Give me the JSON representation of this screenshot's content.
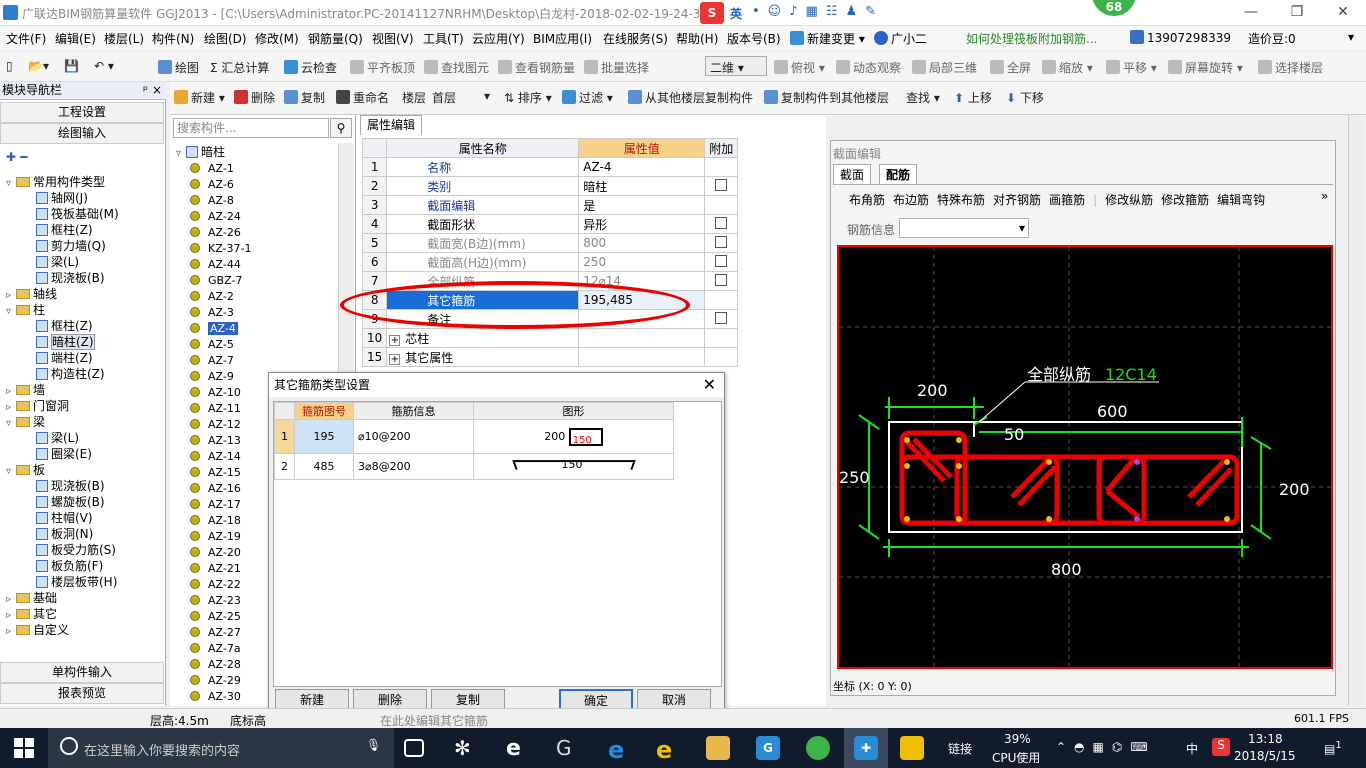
{
  "title": "广联达BIM钢筋算量软件 GGJ2013 - [C:\\Users\\Administrator.PC-20141127NRHM\\Desktop\\白龙村-2018-02-02-19-24-35",
  "ime": {
    "label": "英",
    "badge": "68"
  },
  "menu": [
    "文件(F)",
    "编辑(E)",
    "楼层(L)",
    "构件(N)",
    "绘图(D)",
    "修改(M)",
    "钢筋量(Q)",
    "视图(V)",
    "工具(T)",
    "云应用(Y)",
    "BIM应用(I)",
    "在线服务(S)",
    "帮助(H)",
    "版本号(B)",
    "新建变更",
    "广小二",
    "如何处理筏板附加钢筋...",
    "13907298339",
    "造价豆:0"
  ],
  "toolbar": {
    "draw": "绘图",
    "sum": "汇总计算",
    "cloudcheck": "云检查",
    "flatboard": "平齐板顶",
    "findelem": "查找图元",
    "viewsteel": "查看钢筋量",
    "batchsel": "批量选择",
    "view2d": "二维",
    "topview": "俯视",
    "dynobs": "动态观察",
    "local3d": "局部三维",
    "fullscreen": "全屏",
    "zoom": "缩放",
    "pan": "平移",
    "rotate": "屏幕旋转",
    "selfloor": "选择楼层"
  },
  "toolbar2": {
    "new": "新建",
    "delete": "删除",
    "copy": "复制",
    "rename": "重命名",
    "floor_label": "楼层",
    "floor_value": "首层",
    "sort": "排序",
    "filter": "过滤",
    "copyfrom": "从其他楼层复制构件",
    "copyto": "复制构件到其他楼层",
    "find": "查找",
    "up": "上移",
    "down": "下移"
  },
  "nav": {
    "header": "模块导航栏",
    "project_settings": "工程设置",
    "draw_input": "绘图输入",
    "single_input": "单构件输入",
    "report": "报表预览",
    "tree": [
      {
        "label": "常用构件类型",
        "level": 0,
        "type": "folder",
        "exp": "▿"
      },
      {
        "label": "轴网(J)",
        "level": 1
      },
      {
        "label": "筏板基础(M)",
        "level": 1
      },
      {
        "label": "框柱(Z)",
        "level": 1
      },
      {
        "label": "剪力墙(Q)",
        "level": 1
      },
      {
        "label": "梁(L)",
        "level": 1
      },
      {
        "label": "现浇板(B)",
        "level": 1
      },
      {
        "label": "轴线",
        "level": 0,
        "type": "folder",
        "exp": "▹"
      },
      {
        "label": "柱",
        "level": 0,
        "type": "folder",
        "exp": "▿"
      },
      {
        "label": "框柱(Z)",
        "level": 1
      },
      {
        "label": "暗柱(Z)",
        "level": 1,
        "sel": true
      },
      {
        "label": "端柱(Z)",
        "level": 1
      },
      {
        "label": "构造柱(Z)",
        "level": 1
      },
      {
        "label": "墙",
        "level": 0,
        "type": "folder",
        "exp": "▹"
      },
      {
        "label": "门窗洞",
        "level": 0,
        "type": "folder",
        "exp": "▹"
      },
      {
        "label": "梁",
        "level": 0,
        "type": "folder",
        "exp": "▿"
      },
      {
        "label": "梁(L)",
        "level": 1
      },
      {
        "label": "圈梁(E)",
        "level": 1
      },
      {
        "label": "板",
        "level": 0,
        "type": "folder",
        "exp": "▿"
      },
      {
        "label": "现浇板(B)",
        "level": 1
      },
      {
        "label": "螺旋板(B)",
        "level": 1
      },
      {
        "label": "柱帽(V)",
        "level": 1
      },
      {
        "label": "板洞(N)",
        "level": 1
      },
      {
        "label": "板受力筋(S)",
        "level": 1
      },
      {
        "label": "板负筋(F)",
        "level": 1
      },
      {
        "label": "楼层板带(H)",
        "level": 1
      },
      {
        "label": "基础",
        "level": 0,
        "type": "folder",
        "exp": "▹"
      },
      {
        "label": "其它",
        "level": 0,
        "type": "folder",
        "exp": "▹"
      },
      {
        "label": "自定义",
        "level": 0,
        "type": "folder",
        "exp": "▹"
      }
    ]
  },
  "list": {
    "search_placeholder": "搜索构件...",
    "root": "暗柱",
    "items": [
      "AZ-1",
      "AZ-6",
      "AZ-8",
      "AZ-24",
      "AZ-26",
      "KZ-37-1",
      "AZ-44",
      "GBZ-7",
      "AZ-2",
      "AZ-3",
      "AZ-4",
      "AZ-5",
      "AZ-7",
      "AZ-9",
      "AZ-10",
      "AZ-11",
      "AZ-12",
      "AZ-13",
      "AZ-14",
      "AZ-15",
      "AZ-16",
      "AZ-17",
      "AZ-18",
      "AZ-19",
      "AZ-20",
      "AZ-21",
      "AZ-22",
      "AZ-23",
      "AZ-25",
      "AZ-27",
      "AZ-7a",
      "AZ-28",
      "AZ-29",
      "AZ-30"
    ],
    "selected": "AZ-4"
  },
  "props": {
    "tab": "属性编辑",
    "headers": [
      "属性名称",
      "属性值",
      "附加"
    ],
    "rows": [
      {
        "n": "1",
        "name": "名称",
        "value": "AZ-4",
        "style": "blue",
        "chk": false
      },
      {
        "n": "2",
        "name": "类别",
        "value": "暗柱",
        "style": "blue",
        "chk": true
      },
      {
        "n": "3",
        "name": "截面编辑",
        "value": "是",
        "style": "blue",
        "chk": false
      },
      {
        "n": "4",
        "name": "截面形状",
        "value": "异形",
        "style": "",
        "chk": true
      },
      {
        "n": "5",
        "name": "截面宽(B边)(mm)",
        "value": "800",
        "style": "gray",
        "chk": true
      },
      {
        "n": "6",
        "name": "截面高(H边)(mm)",
        "value": "250",
        "style": "gray",
        "chk": true
      },
      {
        "n": "7",
        "name": "全部纵筋",
        "value": "12⌀14",
        "style": "gray",
        "chk": true
      },
      {
        "n": "8",
        "name": "其它箍筋",
        "value": "195,485",
        "style": "sel",
        "chk": false
      },
      {
        "n": "9",
        "name": "备注",
        "value": "",
        "style": "",
        "chk": true
      },
      {
        "n": "10",
        "name": "芯柱",
        "value": "",
        "style": "group",
        "chk": false
      },
      {
        "n": "15",
        "name": "其它属性",
        "value": "",
        "style": "group",
        "chk": false
      }
    ]
  },
  "dialog": {
    "title": "其它箍筋类型设置",
    "headers": [
      "箍筋图号",
      "箍筋信息",
      "图形"
    ],
    "rows": [
      {
        "n": "1",
        "code": "195",
        "info": "⌀10@200",
        "shape_a": "200",
        "shape_b": "150"
      },
      {
        "n": "2",
        "code": "485",
        "info": "3⌀8@200",
        "shape_a": "",
        "shape_b": "150"
      }
    ],
    "buttons": {
      "new": "新建",
      "delete": "删除",
      "copy": "复制",
      "ok": "确定",
      "cancel": "取消"
    }
  },
  "section": {
    "title": "截面编辑",
    "tabs": [
      "截面",
      "配筋"
    ],
    "tools": [
      "布角筋",
      "布边筋",
      "特殊布筋",
      "对齐钢筋",
      "画箍筋",
      "修改纵筋",
      "修改箍筋",
      "编辑弯钩"
    ],
    "rebar_info_label": "钢筋信息",
    "annot_label": "全部纵筋",
    "annot_value": "12C14",
    "dims": {
      "d200top": "200",
      "d600": "600",
      "d50": "50",
      "d250": "250",
      "d200right": "200",
      "d800": "800"
    },
    "coord": "坐标 (X: 0 Y: 0)"
  },
  "status": {
    "floor_height": "层高:4.5m",
    "base_height": "底标高",
    "fps": "601.1 FPS",
    "hint": "在此处编辑其它箍筋"
  },
  "taskbar": {
    "search_placeholder": "在这里输入你要搜索的内容",
    "link": "链接",
    "cpu": "39%",
    "cpu_label": "CPU使用",
    "lang": "中",
    "time": "13:18",
    "date": "2018/5/15",
    "notif": "1"
  }
}
